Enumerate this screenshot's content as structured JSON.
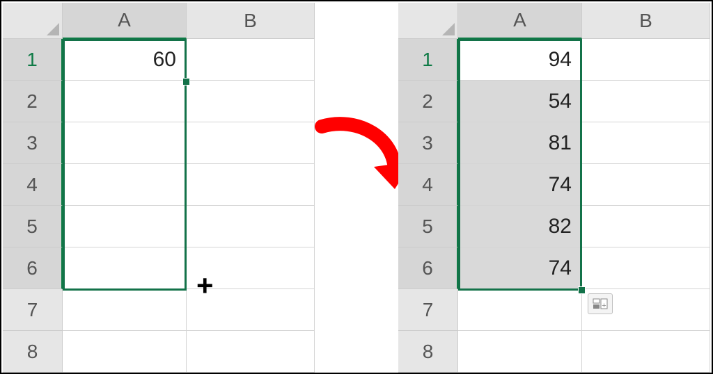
{
  "left": {
    "columns": [
      "A",
      "B"
    ],
    "rows": [
      "1",
      "2",
      "3",
      "4",
      "5",
      "6",
      "7",
      "8"
    ],
    "cells": {
      "A1": "60"
    },
    "selection_range": "A1:A6",
    "active_cell": "A1",
    "fill_cursor": "+"
  },
  "right": {
    "columns": [
      "A",
      "B"
    ],
    "rows": [
      "1",
      "2",
      "3",
      "4",
      "5",
      "6",
      "7",
      "8"
    ],
    "cells": {
      "A1": "94",
      "A2": "54",
      "A3": "81",
      "A4": "74",
      "A5": "82",
      "A6": "74"
    },
    "selection_range": "A1:A6",
    "active_cell": "A1",
    "autofill_button": "auto-fill-options"
  }
}
